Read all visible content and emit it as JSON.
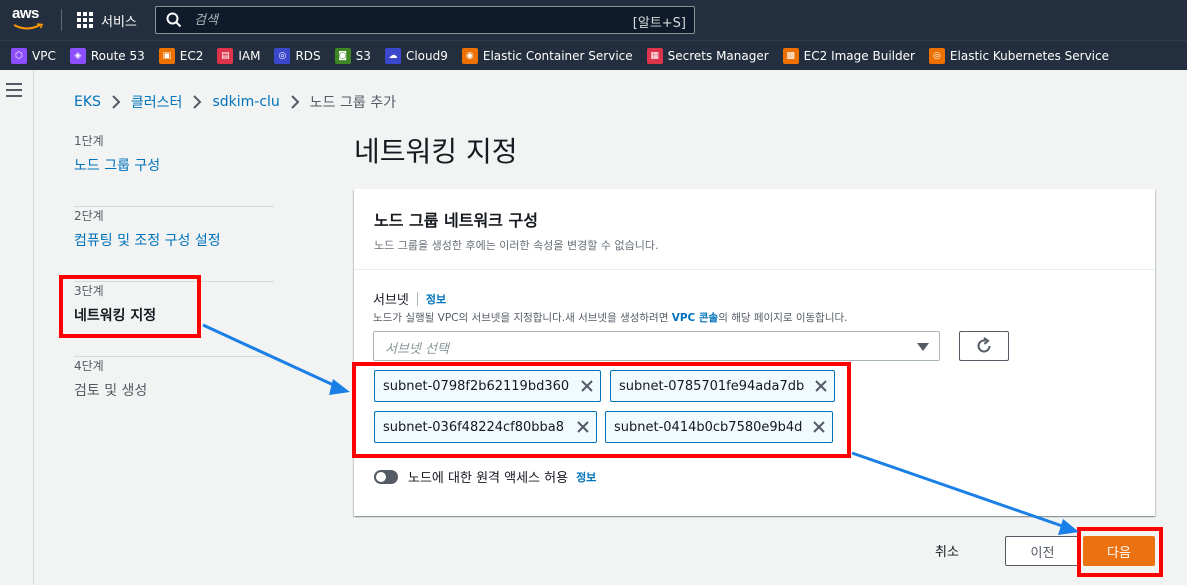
{
  "topnav": {
    "logo_text": "aws",
    "services_label": "서비스",
    "search_placeholder": "검색",
    "search_shortcut": "[알트+S]"
  },
  "favorites": [
    {
      "label": "VPC",
      "color": "#8c4fff",
      "icon": "vpc-icon"
    },
    {
      "label": "Route 53",
      "color": "#8c4fff",
      "icon": "route53-icon"
    },
    {
      "label": "EC2",
      "color": "#ed7100",
      "icon": "ec2-icon"
    },
    {
      "label": "IAM",
      "color": "#dd344c",
      "icon": "iam-icon"
    },
    {
      "label": "RDS",
      "color": "#3b48cc",
      "icon": "rds-icon"
    },
    {
      "label": "S3",
      "color": "#3f8624",
      "icon": "s3-icon"
    },
    {
      "label": "Cloud9",
      "color": "#3b48cc",
      "icon": "cloud9-icon"
    },
    {
      "label": "Elastic Container Service",
      "color": "#ed7100",
      "icon": "ecs-icon"
    },
    {
      "label": "Secrets Manager",
      "color": "#dd344c",
      "icon": "secrets-manager-icon"
    },
    {
      "label": "EC2 Image Builder",
      "color": "#ed7100",
      "icon": "image-builder-icon"
    },
    {
      "label": "Elastic Kubernetes Service",
      "color": "#ed7100",
      "icon": "eks-icon"
    }
  ],
  "breadcrumb": {
    "items": [
      "EKS",
      "클러스터",
      "sdkim-clu"
    ],
    "current": "노드 그룹 추가"
  },
  "steps": [
    {
      "num": "1단계",
      "label": "노드 그룹 구성"
    },
    {
      "num": "2단계",
      "label": "컴퓨팅 및 조정 구성 설정"
    },
    {
      "num": "3단계",
      "label": "네트워킹 지정"
    },
    {
      "num": "4단계",
      "label": "검토 및 생성"
    }
  ],
  "page_title": "네트워킹 지정",
  "panel": {
    "title": "노드 그룹 네트워크 구성",
    "description": "노드 그룹을 생성한 후에는 이러한 속성을 변경할 수 없습니다.",
    "subnet_label": "서브넷",
    "info": "정보",
    "subnet_desc_pre": "노드가 실행될 VPC의 서브넷을 지정합니다.새 서브넷을 생성하려면 ",
    "subnet_desc_link": "VPC 콘솔",
    "subnet_desc_post": "의 해당 페이지로 이동합니다.",
    "select_placeholder": "서브넷 선택",
    "subnets": [
      "subnet-0798f2b62119bd360",
      "subnet-0785701fe94ada7db",
      "subnet-036f48224cf80bba8",
      "subnet-0414b0cb7580e9b4d"
    ],
    "remote_access_label": "노드에 대한 원격 액세스 허용",
    "remote_access_enabled": false
  },
  "footer": {
    "cancel": "취소",
    "previous": "이전",
    "next": "다음"
  },
  "colors": {
    "accent": "#ec7211",
    "link": "#0073bb",
    "highlight": "#ff0000",
    "annotation_arrow": "#1a7fe6"
  }
}
